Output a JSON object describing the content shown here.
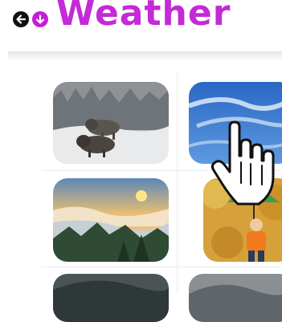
{
  "header": {
    "title": "Weather",
    "back_icon": "arrow-left-icon",
    "secondary_icon": "arrow-down-circle-icon",
    "accent_color": "#c42ad6"
  },
  "grid": {
    "tiles": [
      {
        "name": "bison-snow",
        "icon": "photo"
      },
      {
        "name": "cirrus-sky",
        "icon": "photo"
      },
      {
        "name": "sunrise-clouds-valley",
        "icon": "photo"
      },
      {
        "name": "child-umbrella-autumn",
        "icon": "photo"
      },
      {
        "name": "storm-clouds-1",
        "icon": "photo"
      },
      {
        "name": "storm-clouds-2",
        "icon": "photo"
      }
    ]
  },
  "cursor": {
    "icon": "hand-pointer-icon"
  }
}
